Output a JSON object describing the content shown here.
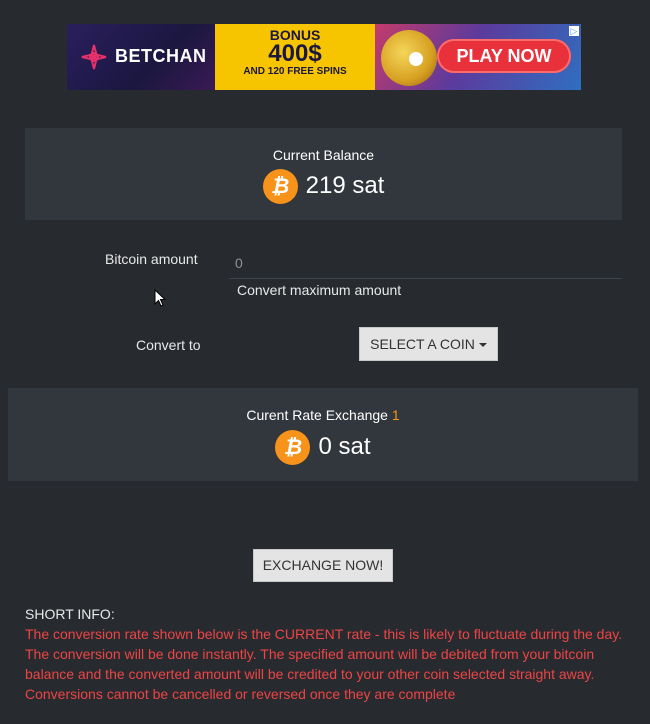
{
  "banner": {
    "brand": "BETCHAN",
    "bonus_label": "BONUS",
    "bonus_amount": "400$",
    "bonus_extra": "AND 120 FREE SPINS",
    "cta": "PLAY NOW"
  },
  "balance": {
    "title": "Current Balance",
    "value": "219 sat",
    "icon": "bitcoin-icon",
    "icon_glyph": "₿"
  },
  "form": {
    "amount_label": "Bitcoin amount",
    "amount_value": "0",
    "max_link": "Convert maximum amount",
    "convert_label": "Convert to",
    "select_coin": "SELECT A COIN"
  },
  "rate": {
    "title": "Curent Rate Exchange",
    "rate_value": "1",
    "value": "0 sat",
    "icon_glyph": "₿"
  },
  "actions": {
    "exchange": "EXCHANGE NOW!"
  },
  "info": {
    "heading": "SHORT INFO:",
    "lines": [
      "The conversion rate shown below is the CURRENT rate - this is likely to fluctuate during the day.",
      "The conversion will be done instantly. The specified amount will be debited from your bitcoin balance and the converted amount will be credited to your other coin selected straight away.",
      "Conversions cannot be cancelled or reversed once they are complete"
    ]
  },
  "colors": {
    "background": "#272b30",
    "panel": "#32373d",
    "bitcoin": "#f7931a",
    "warning": "#ee4444"
  }
}
